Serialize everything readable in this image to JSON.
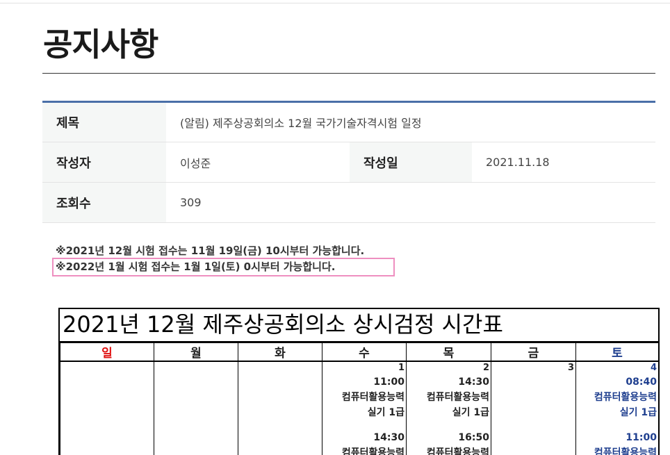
{
  "page": {
    "title": "공지사항"
  },
  "info": {
    "subject_label": "제목",
    "subject_value": "(알림) 제주상공회의소 12월 국가기술자격시험 일정",
    "author_label": "작성자",
    "author_value": "이성준",
    "date_label": "작성일",
    "date_value": "2021.11.18",
    "views_label": "조회수",
    "views_value": "309"
  },
  "notices": {
    "line1": "※2021년 12월 시험 접수는 11월 19일(금) 10시부터 가능합니다.",
    "line2": "※2022년  1월 시험 접수는 1월 1일(토) 0시부터 가능합니다."
  },
  "schedule": {
    "title": "2021년 12월 제주상공회의소 상시검정 시간표",
    "weekdays": [
      "일",
      "월",
      "화",
      "수",
      "목",
      "금",
      "토"
    ],
    "days": [
      {
        "num": "",
        "entries": []
      },
      {
        "num": "",
        "entries": []
      },
      {
        "num": "",
        "entries": []
      },
      {
        "num": "1",
        "entries": [
          {
            "time": "11:00",
            "lines": [
              "컴퓨터활용능력",
              "실기 1급"
            ]
          },
          {
            "time": "14:30",
            "lines": [
              "컴퓨터활용능력"
            ]
          }
        ]
      },
      {
        "num": "2",
        "entries": [
          {
            "time": "14:30",
            "lines": [
              "컴퓨터활용능력",
              "실기 1급"
            ]
          },
          {
            "time": "16:50",
            "lines": [
              "컴퓨터활용능력"
            ]
          }
        ]
      },
      {
        "num": "3",
        "entries": []
      },
      {
        "num": "4",
        "entries": [
          {
            "time": "08:40",
            "lines": [
              "컴퓨터활용능력",
              "실기 1급"
            ]
          },
          {
            "time": "11:00",
            "lines": [
              "컴퓨터활용능력"
            ]
          }
        ]
      }
    ]
  },
  "colors": {
    "accent": "#4a6fa8",
    "sunday": "#e01010",
    "saturday": "#1f3f8f",
    "highlight": "#ee8fc0"
  }
}
